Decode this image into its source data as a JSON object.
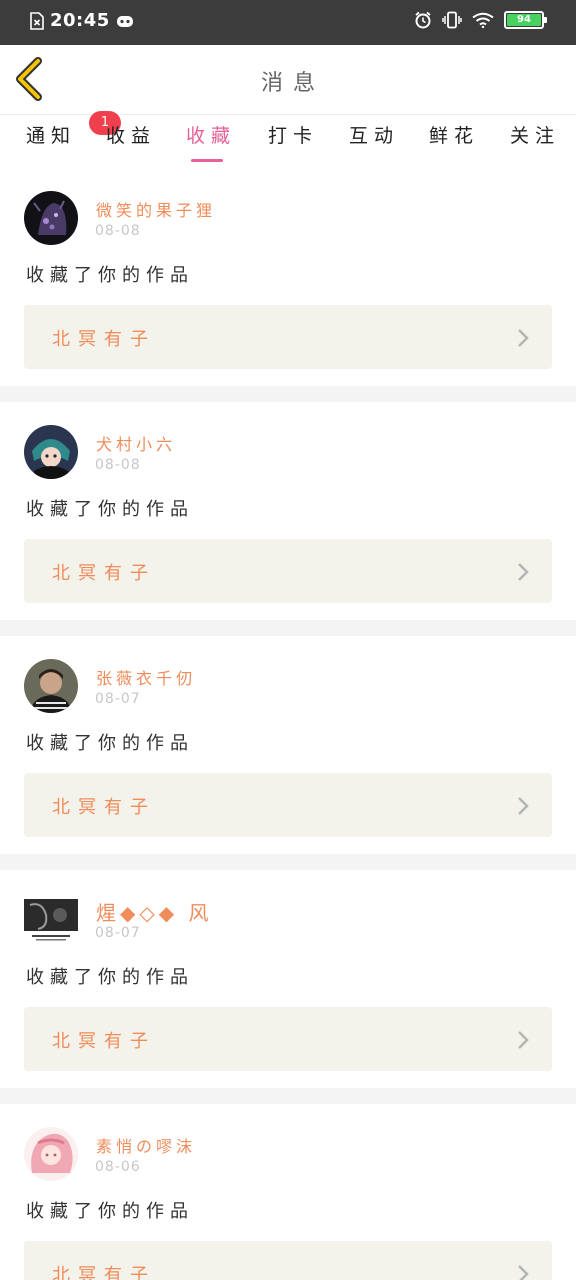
{
  "status_bar": {
    "time": "20:45",
    "battery": "94"
  },
  "header": {
    "title": "消息",
    "back_icon": "chevron-left-icon",
    "accent": "#f5c400"
  },
  "tabs": [
    {
      "label": "通知",
      "badge": "1",
      "active": false
    },
    {
      "label": "收益",
      "active": false
    },
    {
      "label": "收藏",
      "active": true
    },
    {
      "label": "打卡",
      "active": false
    },
    {
      "label": "互动",
      "active": false
    },
    {
      "label": "鲜花",
      "active": false
    },
    {
      "label": "关注",
      "active": false
    }
  ],
  "colors": {
    "active_tab": "#e8609a",
    "username": "#f08c5a",
    "badge": "#f0404e",
    "work_bg": "#f3f3ec"
  },
  "messages": [
    {
      "username": "微笑的果子狸",
      "date": "08-08",
      "action": "收藏了你的作品",
      "work_title": "北冥有子"
    },
    {
      "username": "犬村小六",
      "date": "08-08",
      "action": "收藏了你的作品",
      "work_title": "北冥有子"
    },
    {
      "username": "张薇衣千仞",
      "date": "08-07",
      "action": "收藏了你的作品",
      "work_title": "北冥有子"
    },
    {
      "username": "煋◆◇◆ 风",
      "date": "08-07",
      "action": "收藏了你的作品",
      "work_title": "北冥有子"
    },
    {
      "username": "素悄の嘐沫",
      "date": "08-06",
      "action": "收藏了你的作品",
      "work_title": "北冥有子"
    }
  ]
}
